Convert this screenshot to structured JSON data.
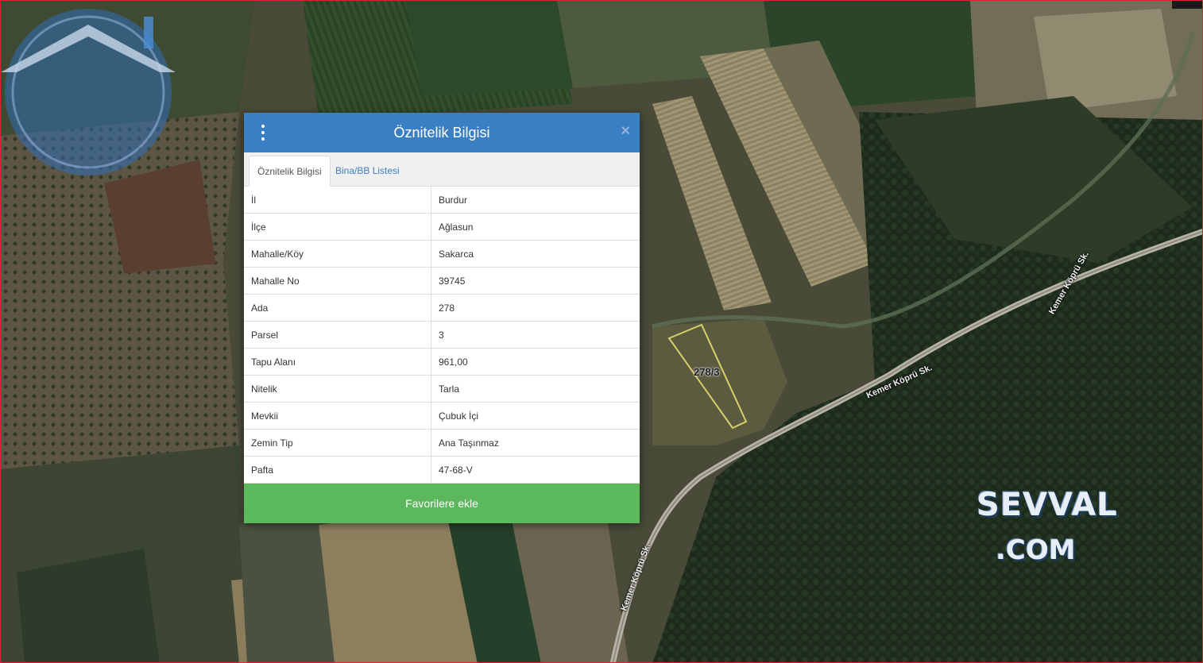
{
  "dialog": {
    "title": "Öznitelik Bilgisi",
    "tabs": [
      {
        "label": "Öznitelik Bilgisi",
        "active": true
      },
      {
        "label": "Bina/BB Listesi",
        "active": false
      }
    ],
    "rows": [
      {
        "key": "İl",
        "value": "Burdur"
      },
      {
        "key": "İlçe",
        "value": "Ağlasun"
      },
      {
        "key": "Mahalle/Köy",
        "value": "Sakarca"
      },
      {
        "key": "Mahalle No",
        "value": "39745"
      },
      {
        "key": "Ada",
        "value": "278"
      },
      {
        "key": "Parsel",
        "value": "3"
      },
      {
        "key": "Tapu Alanı",
        "value": "961,00"
      },
      {
        "key": "Nitelik",
        "value": "Tarla"
      },
      {
        "key": "Mevkii",
        "value": "Çubuk İçi"
      },
      {
        "key": "Zemin Tip",
        "value": "Ana Taşınmaz"
      },
      {
        "key": "Pafta",
        "value": "47-68-V"
      }
    ],
    "favorite_button": "Favorilere ekle",
    "menu_icon": "kebab-menu-icon",
    "close_icon": "close-icon",
    "header_color": "#3a7fc4",
    "button_color": "#5cb85c"
  },
  "map": {
    "parcel_label": "278/3",
    "road_labels": [
      "Kemer Köprü Sk.",
      "Kemer Köprü Sk.",
      "Kemer Köprü Sk."
    ],
    "watermark": {
      "line1": "SEVVAL",
      "line2": ".COM"
    }
  }
}
